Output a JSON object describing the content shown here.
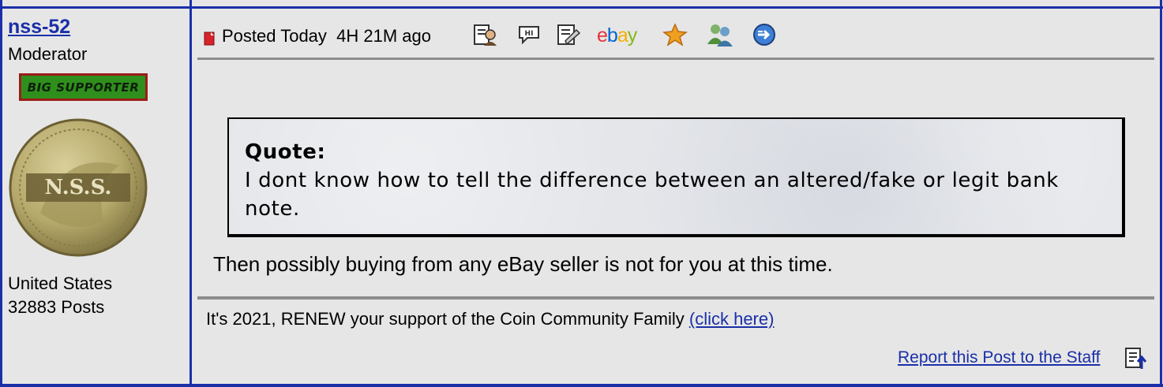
{
  "author": {
    "username": "nss-52",
    "role": "Moderator",
    "badge": "BIG SUPPORTER",
    "avatar_text": "N.S.S.",
    "country": "United States",
    "posts": "32883 Posts"
  },
  "post": {
    "posted": "Posted Today  4H 21M ago",
    "ebay_label": "ebay",
    "quote_label": "Quote:",
    "quote_text": "I dont know how to tell the difference between an altered/fake or legit bank note.",
    "reply_text": "Then possibly buying from any eBay seller is not for you at this time."
  },
  "footer": {
    "renew_text": "It's 2021, RENEW your support of the Coin Community Family ",
    "renew_link": "(click here)",
    "report_label": "Report this Post to the Staff"
  },
  "colors": {
    "link": "#1a2fa8",
    "border": "#1a2fa8",
    "background": "#e6e6e6",
    "badge_green": "#2f8f1c",
    "badge_border": "#9b1d17"
  },
  "icons": [
    "profile-icon",
    "message-icon",
    "edit-icon",
    "ebay-logo",
    "favorite-star-icon",
    "buddy-icon",
    "forward-icon",
    "report-icon"
  ]
}
